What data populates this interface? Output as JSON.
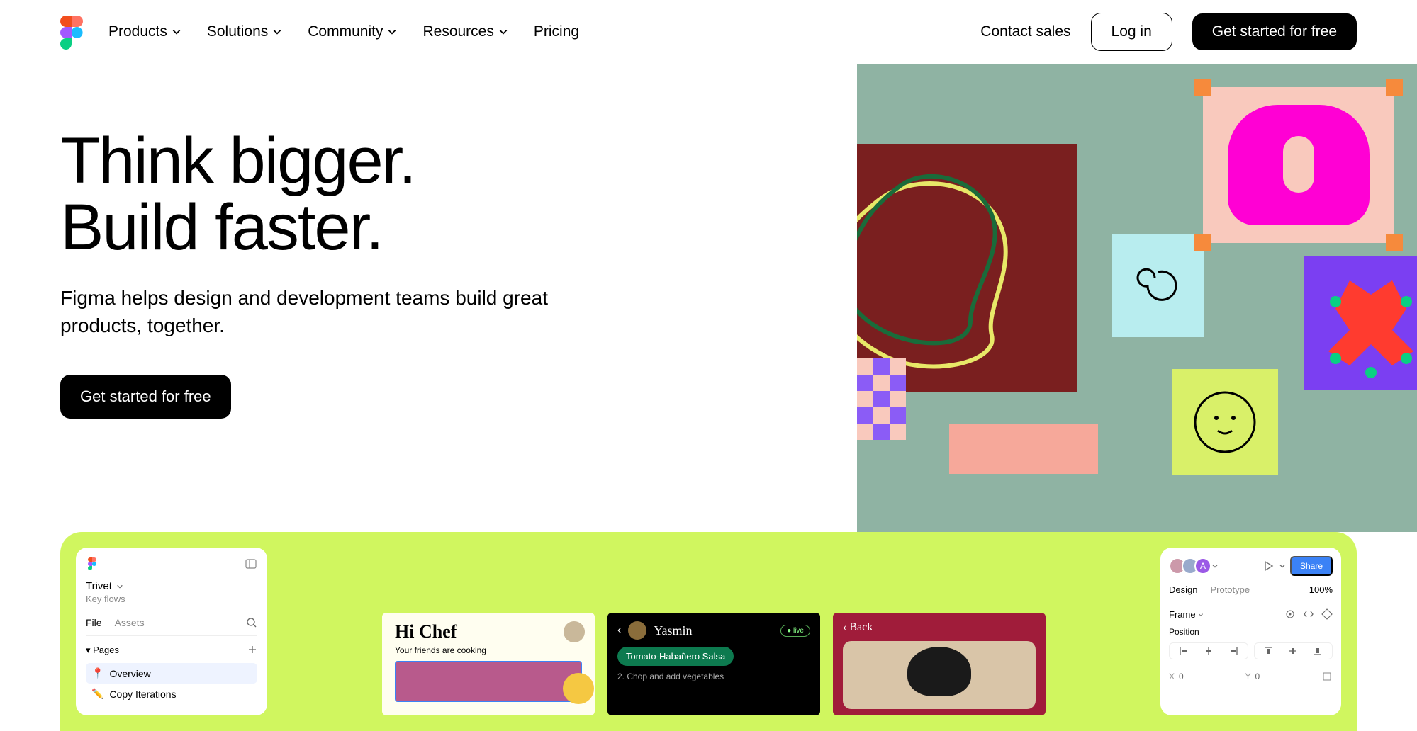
{
  "nav": {
    "items": [
      "Products",
      "Solutions",
      "Community",
      "Resources",
      "Pricing"
    ]
  },
  "header": {
    "contact": "Contact sales",
    "login": "Log in",
    "cta": "Get started for free"
  },
  "hero": {
    "title_line1": "Think bigger.",
    "title_line2": "Build faster.",
    "subtitle": "Figma helps design and development teams build great products, together.",
    "cta": "Get started for free"
  },
  "app": {
    "left": {
      "project": "Trivet",
      "subtitle": "Key flows",
      "tabs": {
        "file": "File",
        "assets": "Assets"
      },
      "pages_label": "Pages",
      "pages": [
        {
          "icon": "📍",
          "label": "Overview"
        },
        {
          "icon": "✏️",
          "label": "Copy Iterations"
        }
      ]
    },
    "mockups": {
      "m1": {
        "title": "Hi Chef",
        "sub": "Your friends are cooking"
      },
      "m2": {
        "name": "Yasmin",
        "live": "● live",
        "recipe": "Tomato-Habañero Salsa",
        "step": "2.  Chop and add vegetables"
      },
      "m3": {
        "back": "‹  Back"
      }
    },
    "right": {
      "avatar_letter": "A",
      "share": "Share",
      "tabs": {
        "design": "Design",
        "prototype": "Prototype"
      },
      "zoom": "100%",
      "frame": "Frame",
      "position": "Position",
      "x_label": "X",
      "x_val": "0",
      "y_label": "Y",
      "y_val": "0"
    }
  }
}
